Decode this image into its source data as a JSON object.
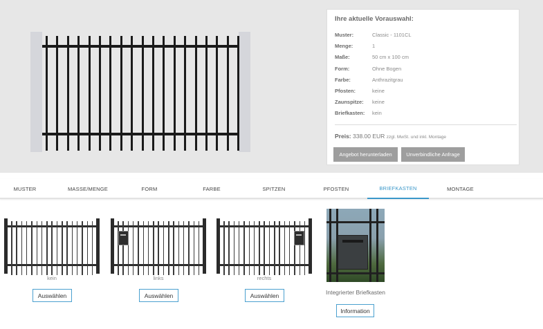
{
  "summary": {
    "heading": "Ihre aktuelle Vorauswahl:",
    "rows": [
      {
        "key": "Muster:",
        "value": "Classic - 1101CL"
      },
      {
        "key": "Menge:",
        "value": "1"
      },
      {
        "key": "Maße:",
        "value": "50 cm x 100 cm"
      },
      {
        "key": "Form:",
        "value": "Ohne Bogen"
      },
      {
        "key": "Farbe:",
        "value": "Anthrazitgrau"
      },
      {
        "key": "Pfosten:",
        "value": "keine"
      },
      {
        "key": "Zaunspitze:",
        "value": "keine"
      },
      {
        "key": "Briefkasten:",
        "value": "kein"
      }
    ],
    "price_label": "Preis:",
    "price_value": "338.00 EUR",
    "price_note": "zzgl. MwSt. und inkl. Montage",
    "download_button": "Angebot herunterladen",
    "request_button": "Unverbindliche Anfrage"
  },
  "tabs": [
    {
      "label": "MUSTER",
      "active": false
    },
    {
      "label": "MASSE/MENGE",
      "active": false
    },
    {
      "label": "FORM",
      "active": false
    },
    {
      "label": "FARBE",
      "active": false
    },
    {
      "label": "SPITZEN",
      "active": false
    },
    {
      "label": "PFOSTEN",
      "active": false
    },
    {
      "label": "BRIEFKASTEN",
      "active": true
    },
    {
      "label": "MONTAGE",
      "active": false
    }
  ],
  "options": [
    {
      "label": "kein",
      "button": "Auswählen",
      "mailbox": "none"
    },
    {
      "label": "links",
      "button": "Auswählen",
      "mailbox": "left"
    },
    {
      "label": "rechts",
      "button": "Auswählen",
      "mailbox": "right"
    }
  ],
  "integrated": {
    "label": "Integrierter Briefkasten",
    "button": "Information"
  },
  "colors": {
    "accent": "#3a97c9",
    "fence": "#1a1a1a",
    "button_gray": "#9e9e9e"
  }
}
